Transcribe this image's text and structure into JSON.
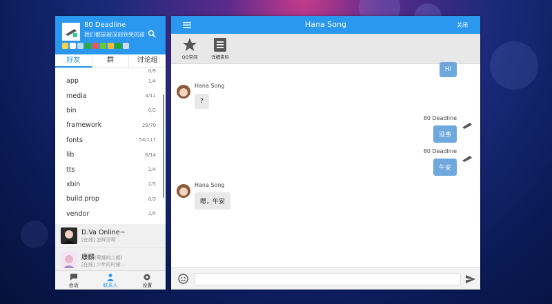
{
  "me": {
    "name": "80 Deadline",
    "signature": "我们都是被深刻到哭的孩..."
  },
  "tabs": [
    "好友",
    "群",
    "讨论组"
  ],
  "groups": [
    {
      "name": "",
      "count": "0/9"
    },
    {
      "name": "app",
      "count": "1/4"
    },
    {
      "name": "media",
      "count": "4/11"
    },
    {
      "name": "bin",
      "count": "0/2"
    },
    {
      "name": "framework",
      "count": "28/70"
    },
    {
      "name": "fonts",
      "count": "54/117"
    },
    {
      "name": "lib",
      "count": "6/14"
    },
    {
      "name": "tts",
      "count": "2/4"
    },
    {
      "name": "xbin",
      "count": "2/5"
    },
    {
      "name": "build.prop",
      "count": "0/3"
    },
    {
      "name": "vendor",
      "count": "2/5"
    }
  ],
  "friends": [
    {
      "name": "D.Va Online~",
      "sub": "[在线] 怎样没啊",
      "extra": ""
    },
    {
      "name": "康麟",
      "sub": "[在线] 少年的时候...",
      "extra": "(荣耀的二朗)"
    }
  ],
  "footer": [
    "会话",
    "联系人",
    "设置"
  ],
  "chat": {
    "title": "Hana Song",
    "close": "关闭",
    "tools": [
      "QQ空间",
      "详细资料"
    ],
    "messages": [
      {
        "from": "me",
        "sender": "",
        "text": "Hi"
      },
      {
        "from": "them",
        "sender": "Hana Song",
        "text": "?"
      },
      {
        "from": "me",
        "sender": "80 Deadline",
        "text": "没事"
      },
      {
        "from": "me",
        "sender": "80 Deadline",
        "text": "午安"
      },
      {
        "from": "them",
        "sender": "Hana Song",
        "text": "嗯，午安"
      }
    ],
    "input_placeholder": ""
  },
  "colors": {
    "accent": "#2b98f0",
    "my_bubble": "#6fa8dc"
  }
}
